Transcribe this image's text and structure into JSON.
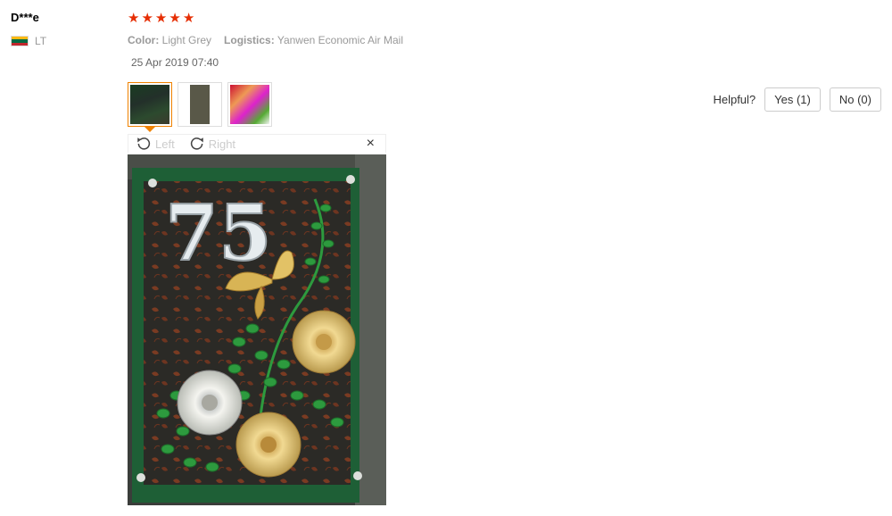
{
  "reviewer": {
    "name": "D***e",
    "country": "LT"
  },
  "review": {
    "rating": 5,
    "star_glyph": "★",
    "color_label": "Color:",
    "color_value": "Light Grey",
    "logistics_label": "Logistics:",
    "logistics_value": "Yanwen Economic Air Mail",
    "date": "25 Apr 2019 07:40"
  },
  "helpful": {
    "label": "Helpful?",
    "yes": "Yes (1)",
    "no": "No (0)"
  },
  "viewer": {
    "rotate_left": "Left",
    "rotate_right": "Right",
    "close": "×"
  },
  "photo": {
    "number_text": "75"
  },
  "colors": {
    "star": "#e62e04",
    "thumb_active": "#f08200"
  }
}
